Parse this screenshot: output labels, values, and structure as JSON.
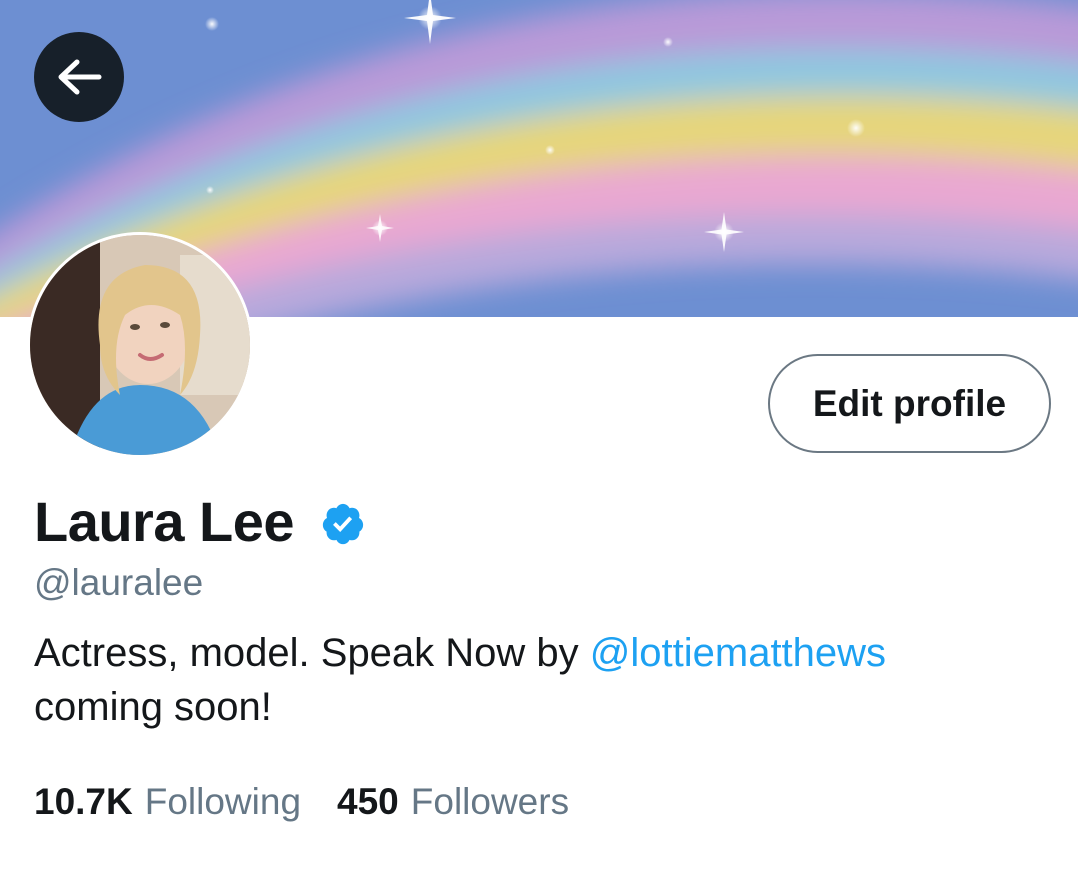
{
  "header": {
    "back_button": {
      "icon": "arrow-left-icon"
    }
  },
  "profile": {
    "name": "Laura Lee",
    "verified_icon": "verified-badge-icon",
    "handle": "@lauralee",
    "edit_profile_label": "Edit profile",
    "bio": {
      "text_before": "Actress, model. Speak Now by ",
      "mention": "@lottiematthews",
      "text_after": "coming soon!"
    },
    "stats": {
      "following_count": "10.7K",
      "following_label": "Following",
      "followers_count": "450",
      "followers_label": "Followers"
    }
  },
  "colors": {
    "accent": "#1da1f2",
    "secondary_text": "#657786",
    "primary_text": "#14171a"
  }
}
